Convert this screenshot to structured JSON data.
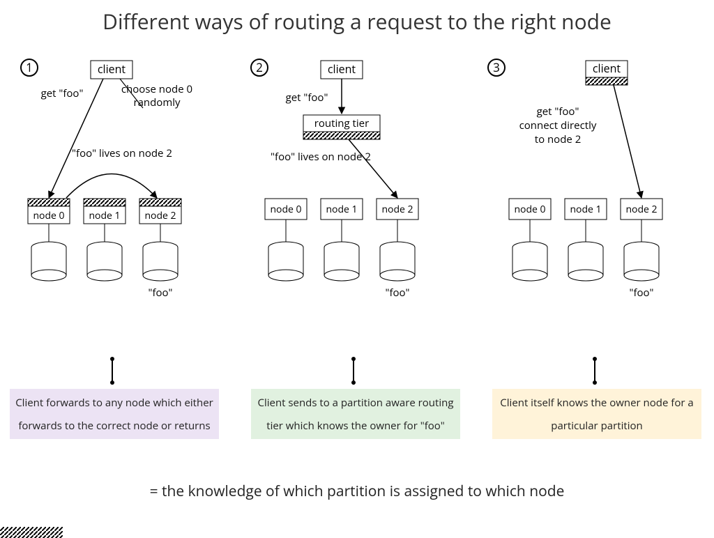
{
  "title": "Different ways of routing a request to the right node",
  "legend_text": "= the knowledge of which partition is assigned to which node",
  "panels": {
    "p1": {
      "num": "1",
      "client": "client",
      "get": "get \"foo\"",
      "choose_a": "choose node 0",
      "choose_b": "randomly",
      "lives": "\"foo\" lives on node 2",
      "n0": "node 0",
      "n1": "node 1",
      "n2": "node 2",
      "foo": "\"foo\"",
      "caption": "Client forwards to any node which either forwards to the correct node or returns"
    },
    "p2": {
      "num": "2",
      "client": "client",
      "get": "get \"foo\"",
      "tier": "routing tier",
      "lives": "\"foo\" lives on node 2",
      "n0": "node 0",
      "n1": "node 1",
      "n2": "node 2",
      "foo": "\"foo\"",
      "caption": "Client sends to a partition aware routing tier which knows the owner for \"foo\""
    },
    "p3": {
      "num": "3",
      "client": "client",
      "get": "get \"foo\"",
      "connect_a": "connect directly",
      "connect_b": "to node 2",
      "n0": "node 0",
      "n1": "node 1",
      "n2": "node 2",
      "foo": "\"foo\"",
      "caption": "Client itself knows the owner node for a particular partition"
    }
  }
}
